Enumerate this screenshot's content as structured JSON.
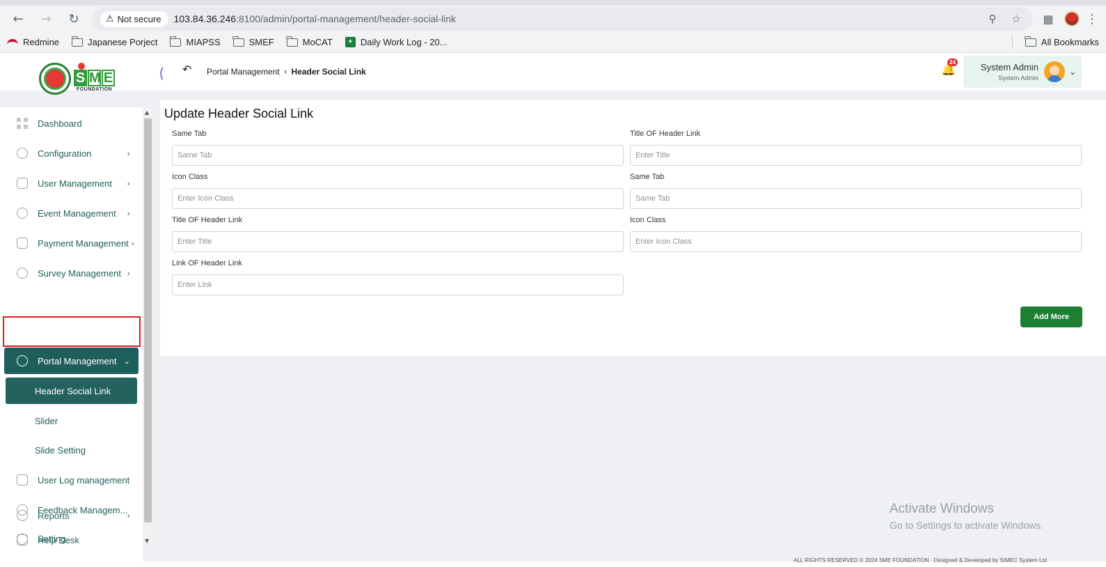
{
  "browser": {
    "back_icon": "arrow-left",
    "forward_icon": "arrow-right",
    "reload_icon": "reload",
    "security_label": "Not secure",
    "url_host": "103.84.36.246",
    "url_rest": ":8100/admin/portal-management/header-social-link",
    "bookmarks": [
      {
        "label": "Redmine"
      },
      {
        "label": "Japanese Porject"
      },
      {
        "label": "MIAPSS"
      },
      {
        "label": "SMEF"
      },
      {
        "label": "MoCAT"
      },
      {
        "label": "Daily Work Log - 20..."
      }
    ],
    "all_bookmarks": "All Bookmarks"
  },
  "header": {
    "logo_letters": [
      "S",
      "M",
      "E"
    ],
    "logo_caption": "FOUNDATION",
    "breadcrumb_parent": "Portal Management",
    "breadcrumb_current": "Header Social Link",
    "notification_count": "24",
    "user_name": "System Admin",
    "user_role": "System Admin"
  },
  "sidebar": {
    "items": [
      {
        "label": "Dashboard"
      },
      {
        "label": "Configuration"
      },
      {
        "label": "User Management"
      },
      {
        "label": "Event Management"
      },
      {
        "label": "Payment Management"
      },
      {
        "label": "Survey Management"
      },
      {
        "label": "Portal Management"
      },
      {
        "label": "User Log management"
      },
      {
        "label": "Feedback Managem..."
      },
      {
        "label": "Help Desk"
      },
      {
        "label": "Reports"
      },
      {
        "label": "Setting"
      }
    ],
    "sub_items": [
      {
        "label": "Header Social Link"
      },
      {
        "label": "Slider"
      },
      {
        "label": "Slide Setting"
      }
    ]
  },
  "form": {
    "title": "Update Header Social Link",
    "fields": [
      {
        "label": "Same Tab",
        "placeholder": "Same Tab",
        "value": ""
      },
      {
        "label": "Title OF Header Link",
        "placeholder": "Enter Title",
        "value": ""
      },
      {
        "label": "Icon Class",
        "placeholder": "Enter Icon Class",
        "value": ""
      },
      {
        "label": "Same Tab",
        "placeholder": "Same Tab",
        "value": ""
      },
      {
        "label": "Title OF Header Link",
        "placeholder": "Enter Title",
        "value": ""
      },
      {
        "label": "Icon Class",
        "placeholder": "Enter Icon Class",
        "value": ""
      },
      {
        "label": "Link OF Header Link",
        "placeholder": "Enter Link",
        "value": ""
      }
    ],
    "add_more": "Add More"
  },
  "watermark": {
    "title": "Activate Windows",
    "subtitle": "Go to Settings to activate Windows."
  },
  "footer": {
    "text": "ALL RIGHTS RESERVED © 2024 SME FOUNDATION · Designed & Developed by SIMEC System Ltd"
  },
  "colors": {
    "primary": "#1e5f5b",
    "button": "#1e7e34",
    "highlight": "#e01b24",
    "badge": "#d32f2f"
  }
}
